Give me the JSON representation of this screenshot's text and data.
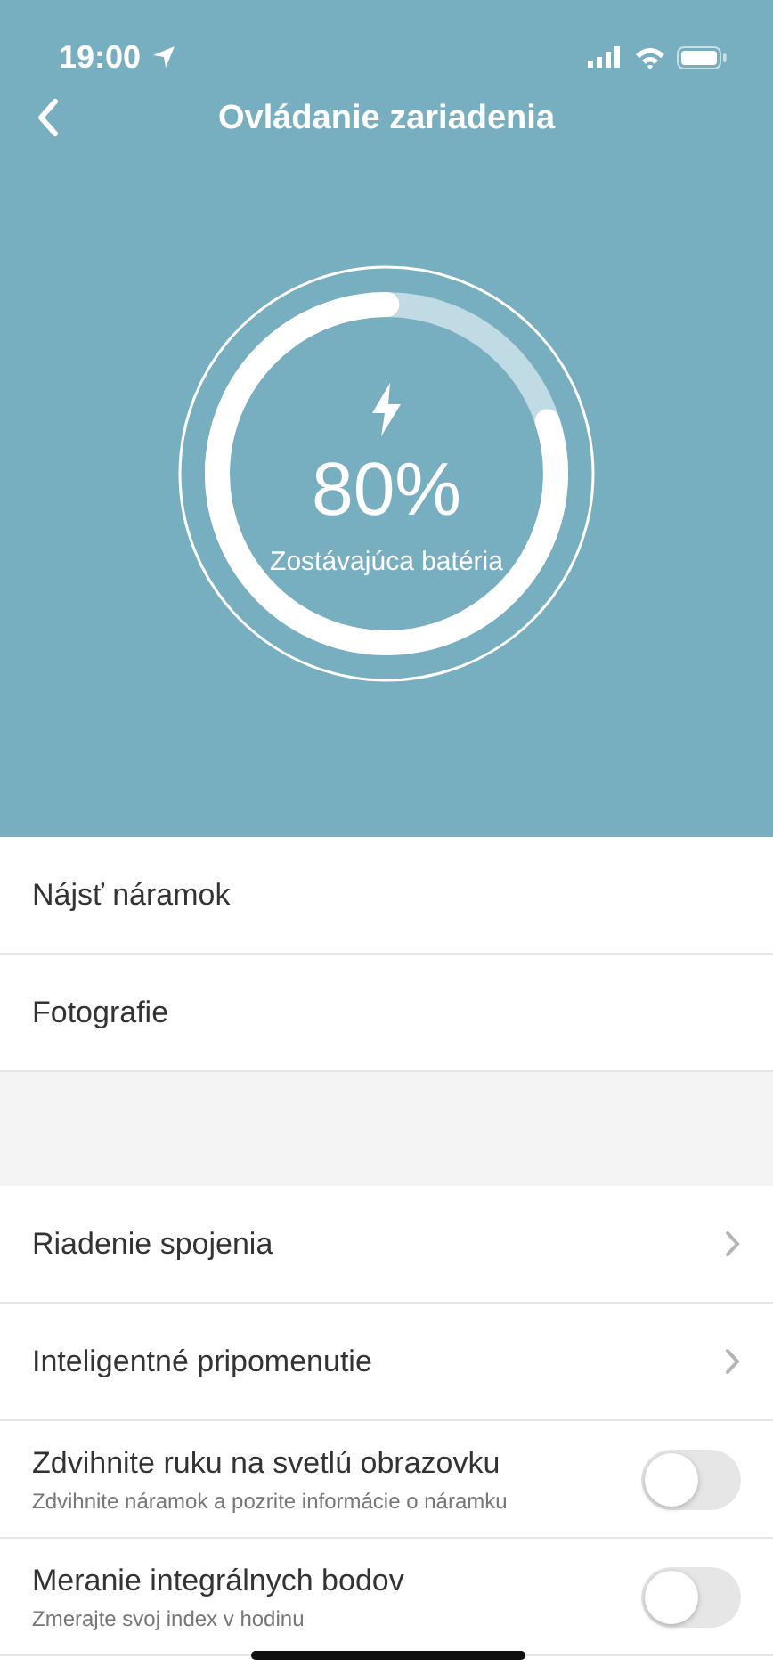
{
  "status_bar": {
    "time": "19:00"
  },
  "header": {
    "title": "Ovládanie zariadenia"
  },
  "battery": {
    "level": 0.8,
    "percent": "80%",
    "label": "Zostávajúca batéria"
  },
  "sections": [
    {
      "items": [
        {
          "kind": "plain",
          "label": "Nájsť náramok"
        },
        {
          "kind": "plain",
          "label": "Fotografie"
        }
      ]
    },
    {
      "items": [
        {
          "kind": "chevron",
          "label": "Riadenie spojenia"
        },
        {
          "kind": "chevron",
          "label": "Inteligentné pripomenutie"
        },
        {
          "kind": "toggle",
          "label": "Zdvihnite ruku na svetlú obrazovku",
          "subtitle": "Zdvihnite náramok a pozrite informácie o náramku",
          "on": false
        },
        {
          "kind": "toggle",
          "label": "Meranie integrálnych bodov",
          "subtitle": "Zmerajte svoj index v hodinu",
          "on": false
        }
      ]
    }
  ]
}
